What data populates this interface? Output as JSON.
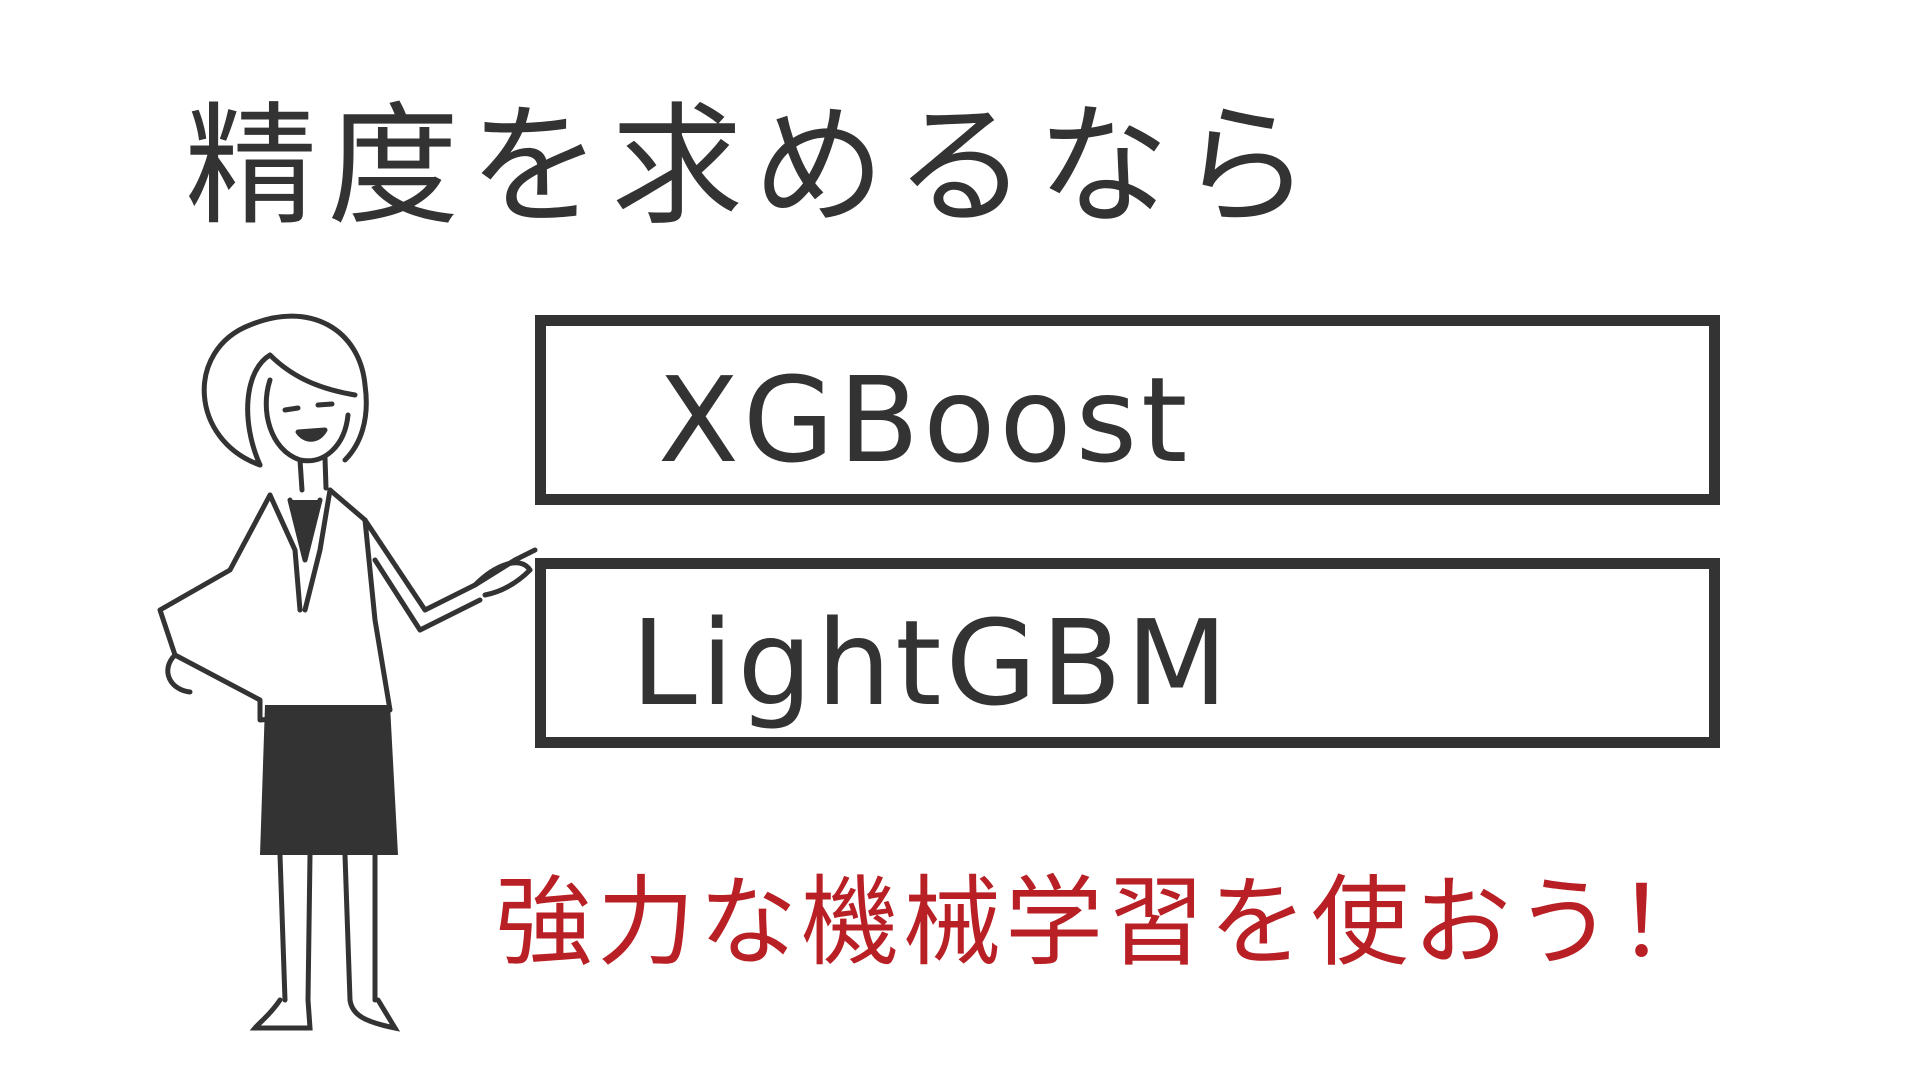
{
  "headline": "精度を求めるなら",
  "cards": [
    {
      "label": "XGBoost"
    },
    {
      "label": "LightGBM"
    }
  ],
  "slogan": "強力な機械学習を使おう！",
  "colors": {
    "ink": "#333333",
    "accent": "#b82025",
    "background": "#ffffff"
  },
  "illustration": "presenter-woman-pointing"
}
